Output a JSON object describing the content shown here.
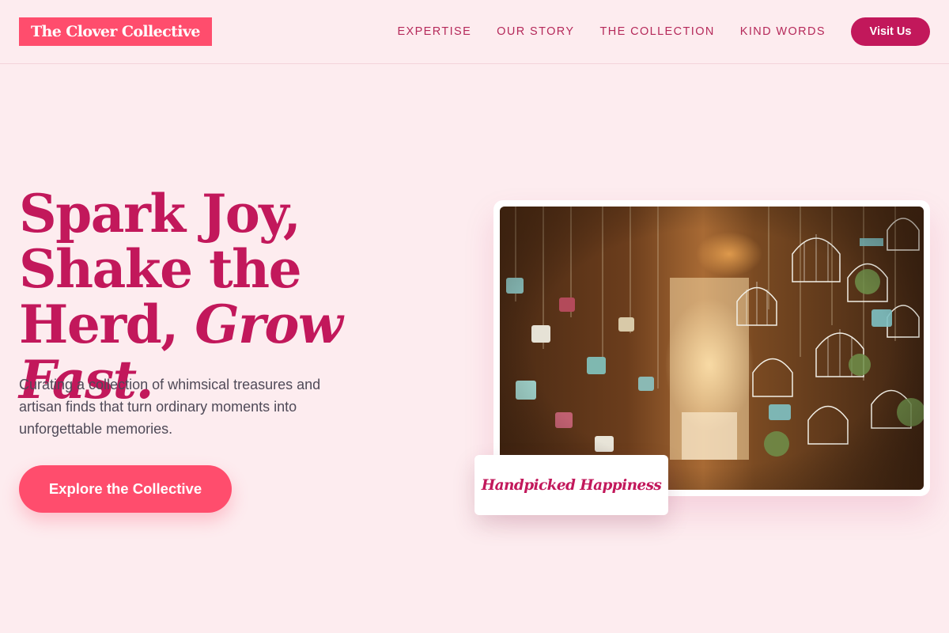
{
  "brand": {
    "name": "The Clover Collective",
    "colors": {
      "primary": "#ff4d6d",
      "accent": "#c2185b",
      "background": "#fdecef"
    }
  },
  "nav": {
    "links": [
      "EXPERTISE",
      "OUR STORY",
      "THE COLLECTION",
      "KIND WORDS"
    ],
    "cta_label": "Visit Us"
  },
  "hero": {
    "title_line1": "Spark Joy, Shake",
    "title_line2": "the Herd,",
    "title_italic": "Grow Fast.",
    "subtitle": "Curating a collection of whimsical treasures and artisan finds that turn ordinary moments into unforgettable memories.",
    "cta_label": "Explore the Collective"
  },
  "feature_image": {
    "subject": "shop interior with hanging birdcages and watering cans",
    "caption": "Handpicked Happiness"
  }
}
